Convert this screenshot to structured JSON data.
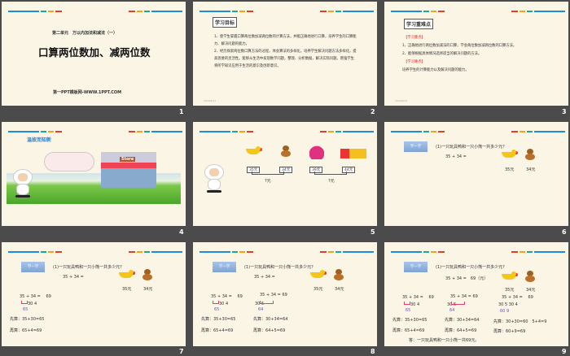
{
  "colors": {
    "slide_bg": "#faf5e4",
    "window_bg": "#4b4b4b",
    "bar_blue": "#1f8dd6",
    "bar_teal": "#1aa89a",
    "bar_orange": "#f4a21c",
    "bar_red": "#e0402a",
    "heading_blue": "#2a7fd4",
    "accent_red": "#e02020"
  },
  "slides": [
    {
      "number": "1",
      "subtitle": "第二单元　万以内加法和减法（一）",
      "title": "口算两位数加、减两位数",
      "footer": "第一PPT模板网-WWW.1PPT.COM"
    },
    {
      "number": "2",
      "heading": "学习目标",
      "paragraphs": [
        "1、使学生掌握口算两位数加减两位数的计算方法，并能正确地进行口算，培养学生的口算能力、解决问题的能力。",
        "2、经历探索两位数口算方法的过程，体会算法的多样化，培养学生解决问题方法多样化，提高思维的灵活性。能够从生活中发现数学问题，整理、分析数据，解决实际问题。增强学生将所学知识应用于生活的意识及创新意识。"
      ],
      "date": "2020/6/11"
    },
    {
      "number": "3",
      "heading": "学习重难点",
      "key_label": "【学习重点】",
      "key_items": [
        "1、正确地进行两位数加减法的口算，学会两位数加减两位数的口算方法。",
        "2、能够根据具体情况选择适当的解决问题的方法。"
      ],
      "difficulty_label": "【学习难点】",
      "difficulty_text": "培养学生的计算能力以及解决问题的能力。",
      "date": "2020/6/11"
    },
    {
      "number": "4",
      "heading": "温故而知新",
      "store_sign": "Store"
    },
    {
      "number": "5",
      "prices": [
        "35元",
        "34元",
        "39元",
        "44元"
      ],
      "question1": "?元",
      "question2": "?元"
    },
    {
      "number": "6",
      "button": "学一学",
      "question": "(1)一只玩具鸭和一只小熊一共多少元？",
      "equation": "35 + 34 =",
      "price_duck": "35元",
      "price_bear": "34元"
    },
    {
      "number": "7",
      "button": "学一学",
      "question": "(1)一只玩具鸭和一只小熊一共多少元？",
      "equation": "35 + 34 =",
      "price_duck": "35元",
      "price_bear": "34元",
      "method1": {
        "eq": "35 + 34 =　 69",
        "split": "30  4",
        "partial": "65",
        "step1": "先算：35+30=65",
        "step2": "再算：65+4=69"
      }
    },
    {
      "number": "8",
      "button": "学一学",
      "question": "(1)一只玩具鸭和一只小熊一共多少元？",
      "equation": "35 + 34 =",
      "price_duck": "35元",
      "price_bear": "34元",
      "method1": {
        "eq": "35 + 34 =　 69",
        "split": "30  4",
        "partial": "65",
        "step1": "先算：35+30=65",
        "step2": "再算：65+4=69"
      },
      "method2": {
        "eq": "35 + 34 =  69",
        "split": "30  5",
        "partial": "64",
        "step1": "先算：30+34=64",
        "step2": "再算：64+5=69"
      }
    },
    {
      "number": "9",
      "button": "学一学",
      "question": "(1)一只玩具鸭和一只小熊一共多少元？",
      "equation": "35 + 34 =　69（元）",
      "price_duck": "35元",
      "price_bear": "34元",
      "method1": {
        "eq": "35 + 34 =　 69",
        "split": "30  4",
        "partial": "65",
        "step1": "先算：35+30=65",
        "step2": "再算：65+4=69"
      },
      "method2": {
        "eq": "35 + 34 =  69",
        "split": "30  5",
        "partial": "64",
        "step1": "先算：30+34=64",
        "step2": "再算：64+5=69"
      },
      "method3": {
        "eq": "35 + 34 =　 69",
        "split": "30  5  30  4",
        "partial": "60   9",
        "step1": "先算：30+30=60　5+4=9",
        "step2": "再算：60+9=69"
      },
      "answer": "答：一只玩具鸭和一只小熊一共69元。"
    }
  ]
}
